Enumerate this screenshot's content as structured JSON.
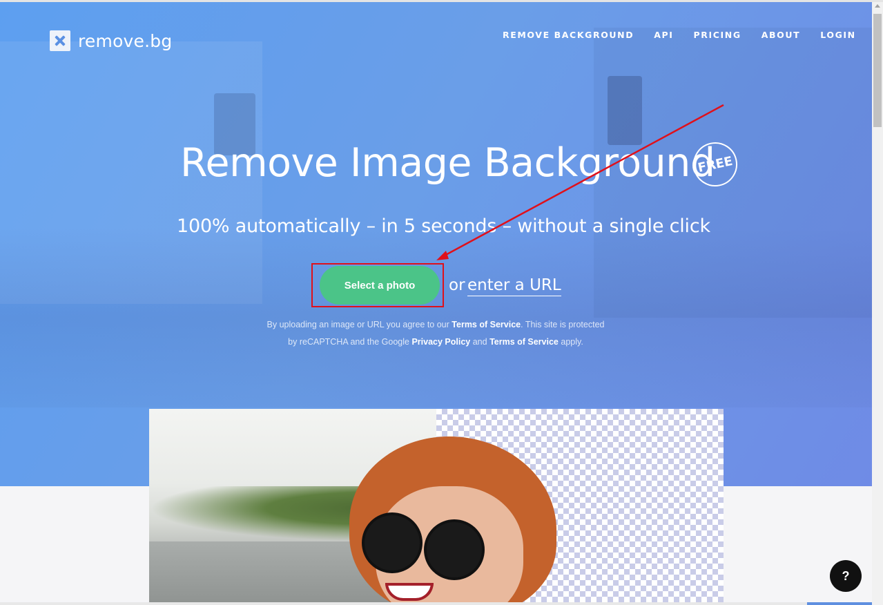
{
  "brand": {
    "name": "remove.bg",
    "logo_icon": "x-logo-icon"
  },
  "nav": {
    "items": [
      {
        "label": "REMOVE BACKGROUND"
      },
      {
        "label": "API"
      },
      {
        "label": "PRICING"
      },
      {
        "label": "ABOUT"
      },
      {
        "label": "LOGIN"
      }
    ]
  },
  "hero": {
    "title": "Remove Image Background",
    "badge": "FREE",
    "subtitle": "100% automatically – in 5 seconds – without a single click",
    "select_button": "Select a photo",
    "or_text": "or",
    "url_link": "enter a URL",
    "legal": {
      "line1_prefix": "By uploading an image or URL you agree to our",
      "terms1": "Terms of Service",
      "line1_suffix": ". This site is protected",
      "line2_prefix": "by reCAPTCHA and the Google",
      "privacy": "Privacy Policy",
      "and": "and",
      "terms2": "Terms of Service",
      "line2_suffix": "apply."
    }
  },
  "help": {
    "label": "?"
  },
  "colors": {
    "hero_blue": "#5d9ff0",
    "button_green": "#4bc488",
    "annotation_red": "#e0101a"
  }
}
